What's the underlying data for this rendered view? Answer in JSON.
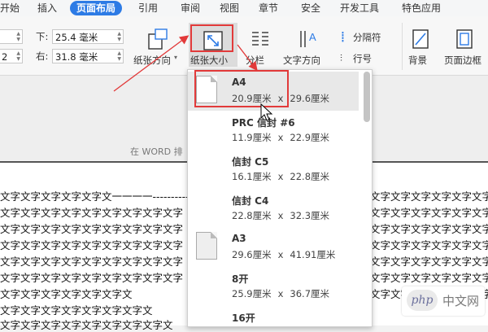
{
  "tabs": [
    {
      "label": "开始"
    },
    {
      "label": "插入"
    },
    {
      "label": "页面布局"
    },
    {
      "label": "引用"
    },
    {
      "label": "审阅"
    },
    {
      "label": "视图"
    },
    {
      "label": "章节"
    },
    {
      "label": "安全"
    },
    {
      "label": "开发工具"
    },
    {
      "label": "特色应用"
    }
  ],
  "margins": {
    "bottom_label": "下:",
    "bottom_value": "25.4 毫米",
    "right_label": "右:",
    "right_value": "31.8 毫米",
    "left_value_partial": "2",
    "top_value_partial": ""
  },
  "ribbon": {
    "orientation": "纸张方向",
    "paper_size": "纸张大小",
    "columns": "分栏",
    "text_direction": "文字方向",
    "section_break": "分隔符",
    "line_numbers": "行号",
    "background": "背景",
    "page_border": "页面边框"
  },
  "document": {
    "header_text": "在 WORD 排",
    "lines": [
      "文字文字文字文字文字文一一一一-----------",
      "文字文字文字文字文字文字文字文字文字",
      "文字文字文字文字文字文字文字文字文字",
      "文字文字文字文字文字文字文字文字文字",
      "文字文字文字文字文字文字文字文字文字",
      "文字文字文字文字文字文字文字文字文字",
      "文字文字文字文字文字文字文",
      "文字文字文字文字文字文字文字文",
      "文字文字文字文字文字文字文字文字文"
    ],
    "right_lines": [
      "文字文字文字文字文字文字",
      "文字文字文字文字文字文字",
      "文字文字文字文字文字文字",
      "文字文字文字文字文字文字",
      "文字文字文字文字文字文字",
      "文字文字文字文字文字文字",
      "文字文字文字文字文字文字"
    ]
  },
  "paper_sizes": [
    {
      "name": "A4",
      "width": "20.9厘米",
      "x": "x",
      "height": "29.6厘米"
    },
    {
      "name": "PRC 信封 #6",
      "width": "11.9厘米",
      "x": "x",
      "height": "22.9厘米"
    },
    {
      "name": "信封 C5",
      "width": "16.1厘米",
      "x": "x",
      "height": "22.8厘米"
    },
    {
      "name": "信封 C4",
      "width": "22.8厘米",
      "x": "x",
      "height": "32.3厘米"
    },
    {
      "name": "A3",
      "width": "29.6厘米",
      "x": "x",
      "height": "41.91厘米"
    },
    {
      "name": "8开",
      "width": "25.9厘米",
      "x": "x",
      "height": "36.7厘米"
    },
    {
      "name": "16开",
      "width": "",
      "x": "",
      "height": ""
    }
  ],
  "watermark": {
    "logo": "php",
    "text": "中文网"
  },
  "colors": {
    "active_tab": "#2d7be5",
    "highlight": "#e23a3a"
  }
}
